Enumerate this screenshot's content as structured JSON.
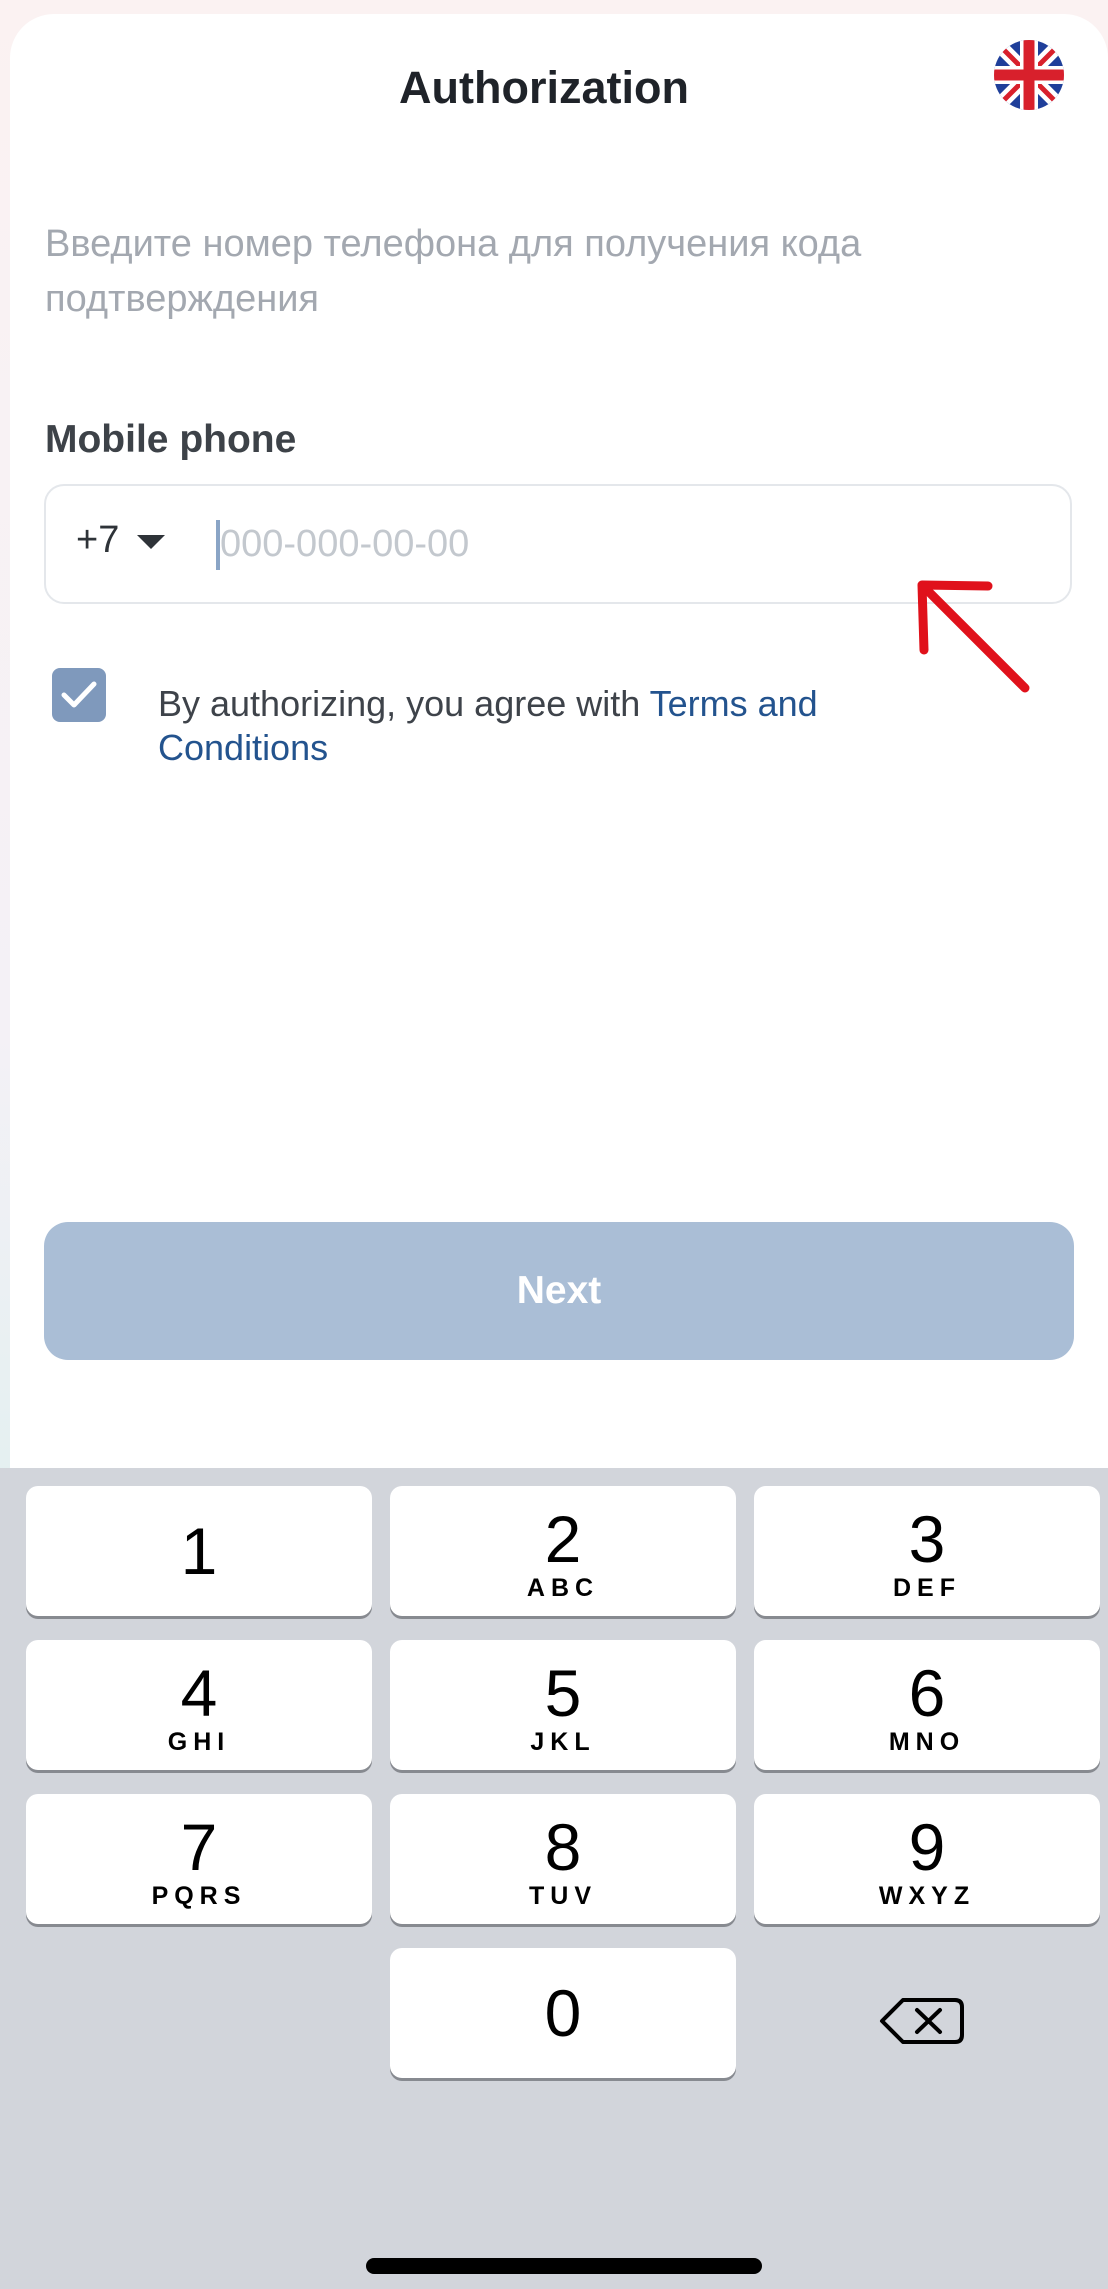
{
  "header": {
    "title": "Authorization",
    "language_icon": "uk-flag-icon"
  },
  "form": {
    "subtitle": "Введите номер телефона для получения кода подтверждения",
    "phone_label": "Mobile phone",
    "country_code": "+7",
    "phone_placeholder": "000-000-00-00",
    "phone_value": "",
    "agreement_checked": true,
    "agreement_text": "By authorizing, you agree with ",
    "agreement_link": "Terms and Conditions"
  },
  "actions": {
    "next_label": "Next"
  },
  "keyboard": {
    "keys": [
      {
        "digit": "1",
        "letters": ""
      },
      {
        "digit": "2",
        "letters": "ABC"
      },
      {
        "digit": "3",
        "letters": "DEF"
      },
      {
        "digit": "4",
        "letters": "GHI"
      },
      {
        "digit": "5",
        "letters": "JKL"
      },
      {
        "digit": "6",
        "letters": "MNO"
      },
      {
        "digit": "7",
        "letters": "PQRS"
      },
      {
        "digit": "8",
        "letters": "TUV"
      },
      {
        "digit": "9",
        "letters": "WXYZ"
      },
      {
        "digit": "0",
        "letters": ""
      }
    ],
    "delete_icon": "backspace-icon"
  },
  "annotation": {
    "arrow_icon": "red-arrow-icon",
    "arrow_color": "#e0111b"
  },
  "colors": {
    "accent": "#23538e",
    "button_disabled": "#aabed6",
    "checkbox": "#7f99bc"
  }
}
